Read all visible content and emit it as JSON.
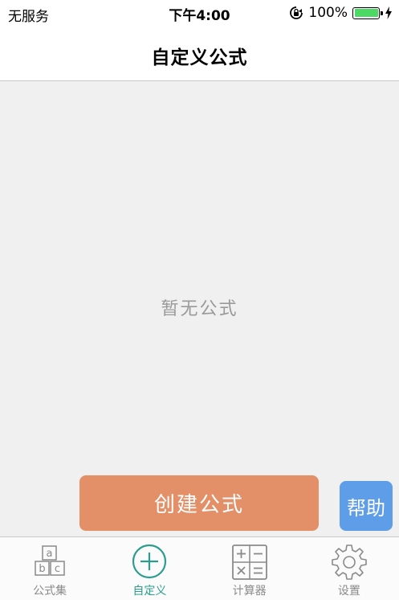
{
  "status_bar": {
    "carrier": "无服务",
    "time": "下午4:00",
    "battery_percent": "100%",
    "battery_level": 1.0
  },
  "nav": {
    "title": "自定义公式"
  },
  "content": {
    "empty_text": "暂无公式"
  },
  "actions": {
    "create_label": "创建公式",
    "help_label": "帮助"
  },
  "tabs": [
    {
      "label": "公式集",
      "icon": "abc-blocks-icon",
      "active": false
    },
    {
      "label": "自定义",
      "icon": "plus-circle-icon",
      "active": true
    },
    {
      "label": "计算器",
      "icon": "calculator-icon",
      "active": false
    },
    {
      "label": "设置",
      "icon": "gear-icon",
      "active": false
    }
  ],
  "colors": {
    "create_button": "#e39068",
    "help_button": "#5e9de8",
    "active_tab": "#2a9d8f",
    "inactive_tab": "#8a8a8a",
    "battery": "#4cd964"
  }
}
